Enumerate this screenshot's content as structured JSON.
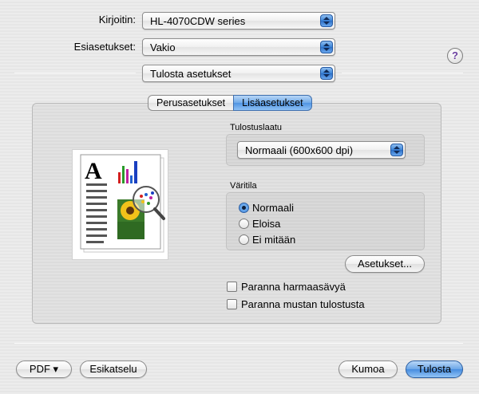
{
  "printer": {
    "label": "Kirjoitin:",
    "value": "HL-4070CDW series"
  },
  "presets": {
    "label": "Esiasetukset:",
    "value": "Vakio"
  },
  "help_icon": "help-icon",
  "section_popup": {
    "value": "Tulosta asetukset"
  },
  "tabs": [
    {
      "label": "Perusasetukset",
      "selected": false
    },
    {
      "label": "Lisäasetukset",
      "selected": true
    }
  ],
  "print_quality": {
    "label": "Tulostuslaatu",
    "value": "Normaali (600x600 dpi)"
  },
  "color_mode": {
    "label": "Väritila",
    "options": [
      {
        "label": "Normaali",
        "selected": true
      },
      {
        "label": "Eloisa",
        "selected": false
      },
      {
        "label": "Ei mitään",
        "selected": false
      }
    ]
  },
  "settings_button": "Asetukset...",
  "checkboxes": [
    {
      "label": "Paranna harmaasävyä",
      "checked": false
    },
    {
      "label": "Paranna mustan tulostusta",
      "checked": false
    }
  ],
  "footer": {
    "pdf": "PDF ▾",
    "preview": "Esikatselu",
    "cancel": "Kumoa",
    "print": "Tulosta"
  },
  "colors": {
    "accent": "#4f93e2",
    "help": "#6b3fa0"
  }
}
